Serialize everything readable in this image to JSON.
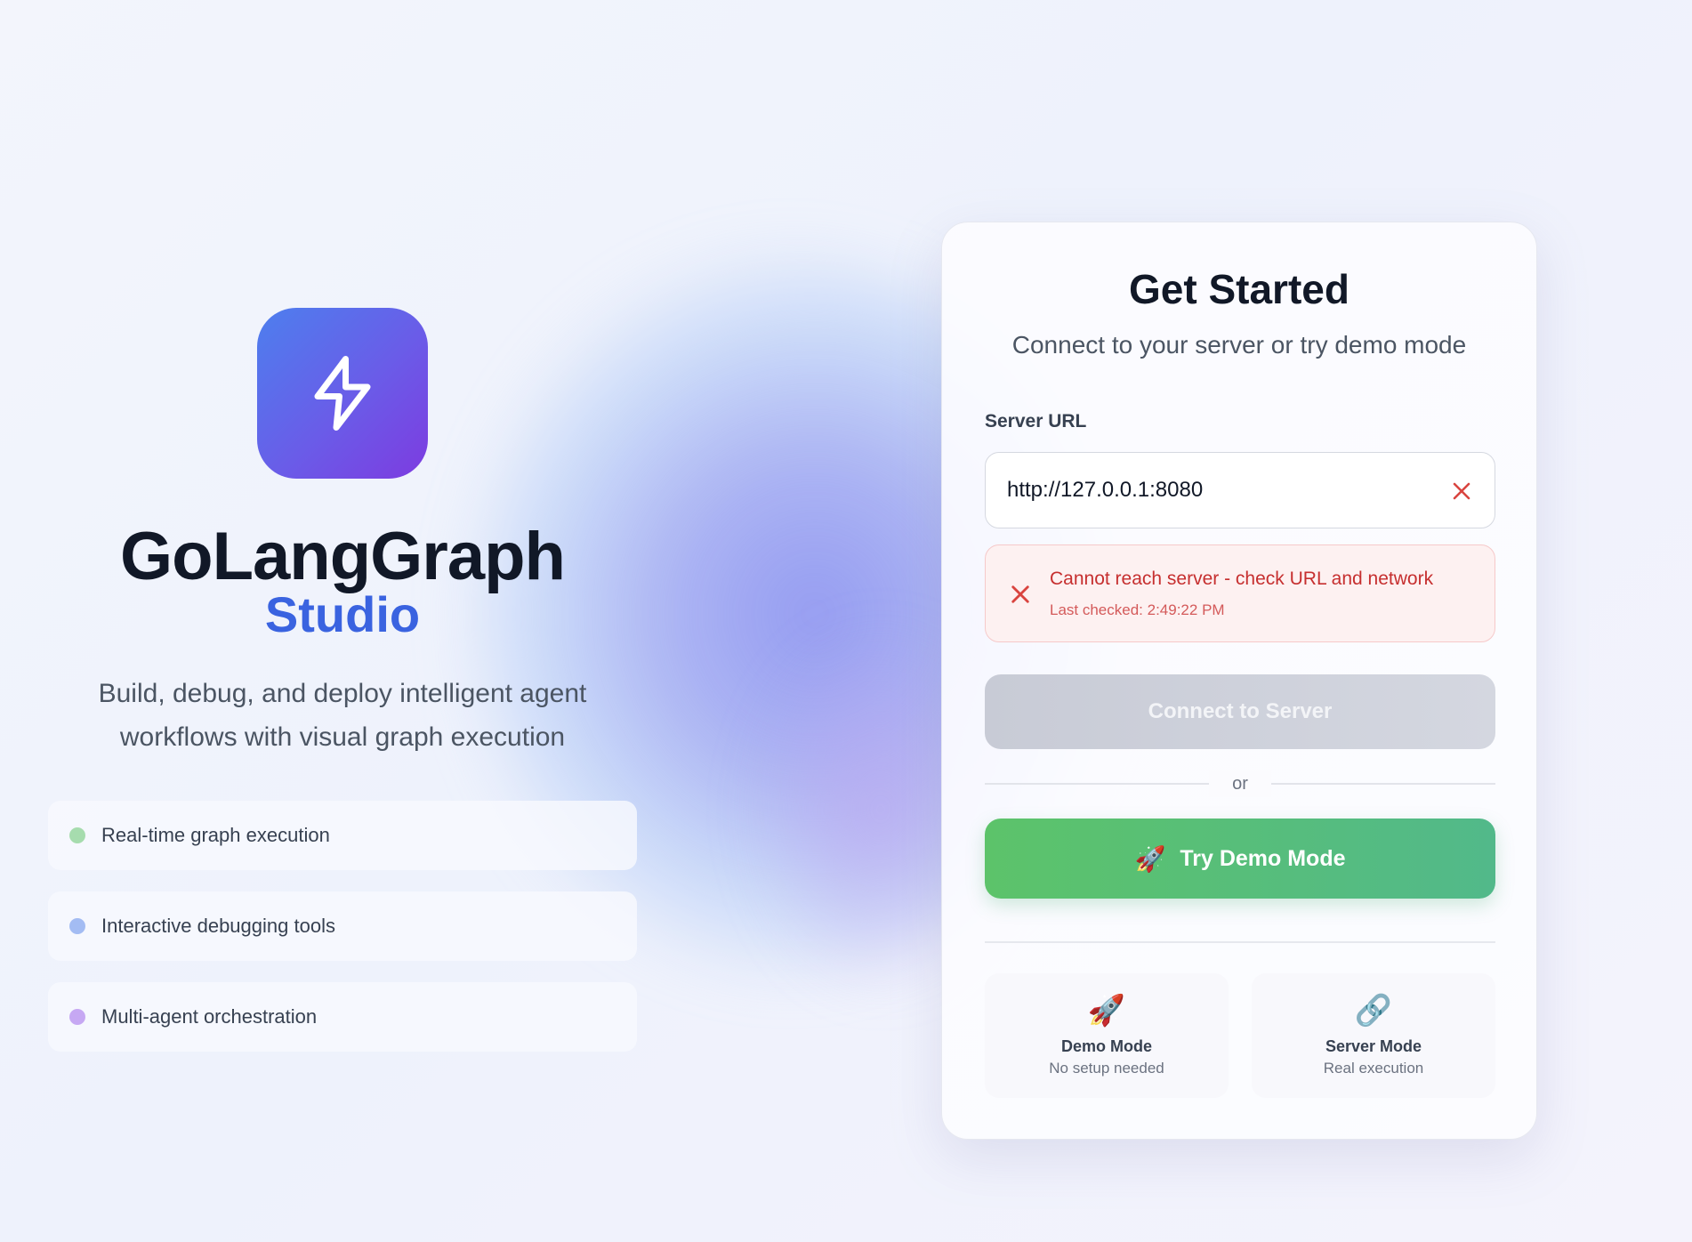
{
  "brand": {
    "title": "GoLangGraph",
    "subtitle": "Studio",
    "tagline_line1": "Build, debug, and deploy intelligent agent",
    "tagline_line2": "workflows with visual graph execution",
    "logo_icon": "lightning-bolt-icon"
  },
  "features": [
    {
      "label": "Real-time graph execution",
      "dot_color": "#a6dcae"
    },
    {
      "label": "Interactive debugging tools",
      "dot_color": "#a3bcf3"
    },
    {
      "label": "Multi-agent orchestration",
      "dot_color": "#c6a8f3"
    }
  ],
  "card": {
    "title": "Get Started",
    "subtitle": "Connect to your server or try demo mode",
    "server_url_label": "Server URL",
    "server_url_value": "http://127.0.0.1:8080",
    "error_message": "Cannot reach server - check URL and network",
    "error_time": "Last checked: 2:49:22 PM",
    "connect_label": "Connect to Server",
    "divider_text": "or",
    "demo_label": "Try Demo Mode",
    "demo_icon": "🚀"
  },
  "modes": [
    {
      "icon": "🚀",
      "title": "Demo Mode",
      "desc": "No setup needed"
    },
    {
      "icon": "🔗",
      "title": "Server Mode",
      "desc": "Real execution"
    }
  ],
  "colors": {
    "accent_blue": "#3a63e0",
    "error_red": "#c62f2f",
    "demo_green": "#5cc36a",
    "logo_gradient_start": "#4d7fee",
    "logo_gradient_end": "#7d3be0"
  }
}
